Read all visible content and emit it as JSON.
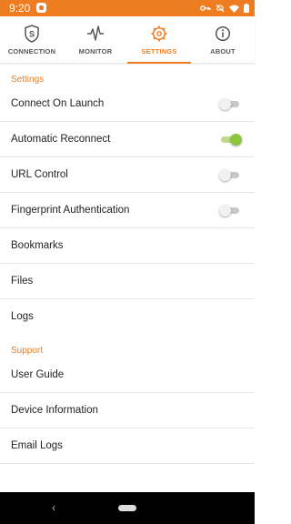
{
  "status_bar": {
    "time": "9:20",
    "icons": [
      "app-notification-icon",
      "vpn-key-icon",
      "mute-icon",
      "wifi-icon",
      "battery-icon"
    ]
  },
  "tabs": [
    {
      "label": "CONNECTION",
      "icon": "shield-s-icon",
      "active": false
    },
    {
      "label": "MONITOR",
      "icon": "pulse-icon",
      "active": false
    },
    {
      "label": "SETTINGS",
      "icon": "gear-icon",
      "active": true
    },
    {
      "label": "ABOUT",
      "icon": "info-icon",
      "active": false
    }
  ],
  "settings": {
    "header": "Settings",
    "items": [
      {
        "label": "Connect On Launch",
        "toggle": false
      },
      {
        "label": "Automatic Reconnect",
        "toggle": true
      },
      {
        "label": "URL Control",
        "toggle": false
      },
      {
        "label": "Fingerprint Authentication",
        "toggle": false
      },
      {
        "label": "Bookmarks"
      },
      {
        "label": "Files"
      },
      {
        "label": "Logs"
      }
    ]
  },
  "support": {
    "header": "Support",
    "items": [
      {
        "label": "User Guide"
      },
      {
        "label": "Device Information"
      },
      {
        "label": "Email Logs"
      }
    ]
  },
  "colors": {
    "accent": "#ee7d22",
    "toggle_on": "#8cc63f"
  }
}
